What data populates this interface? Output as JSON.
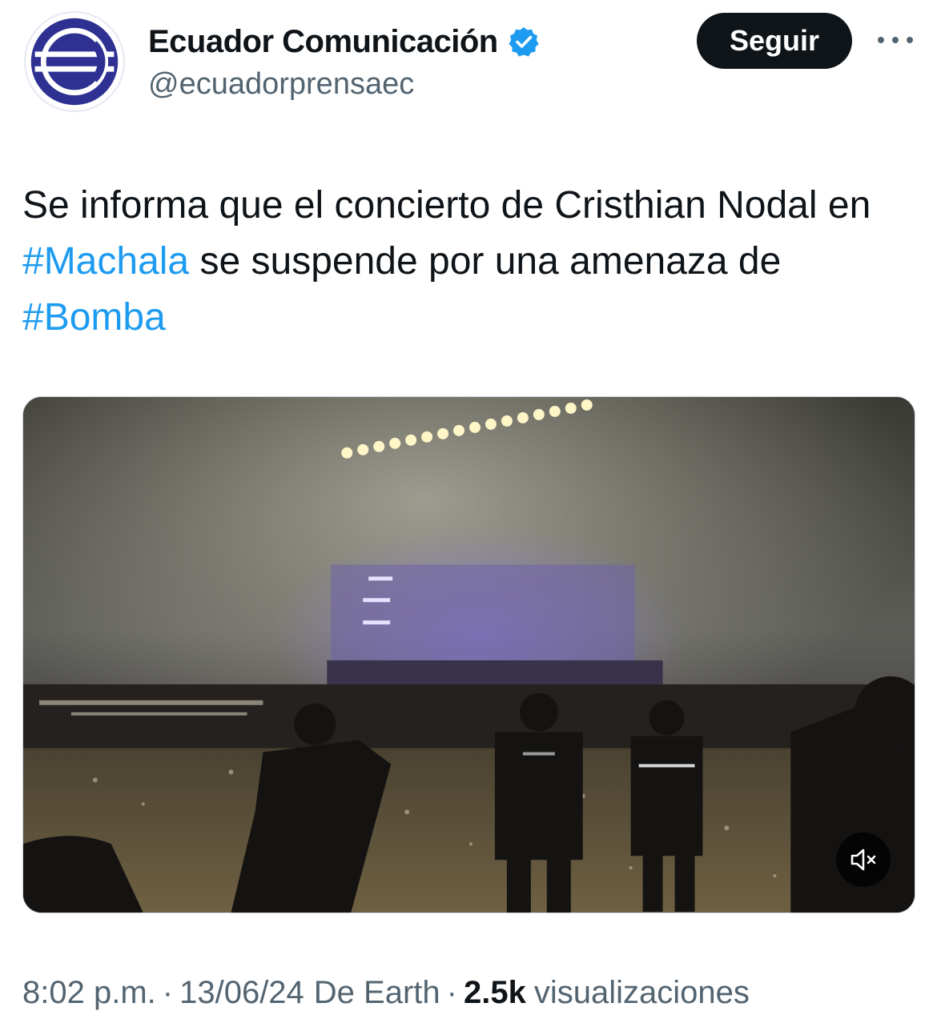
{
  "account": {
    "display_name": "Ecuador Comunicación",
    "handle": "@ecuadorprensaec",
    "verified": true,
    "avatar_icon": "ecuador-comunicacion-logo",
    "brand_color": "#2e3192"
  },
  "actions": {
    "follow_label": "Seguir",
    "more_icon": "more-horizontal-icon"
  },
  "tweet": {
    "text_before": "Se informa que el concierto de Cristhian Nodal en ",
    "hashtag_1": "#Machala",
    "text_middle": " se suspende por una amenaza de ",
    "hashtag_2": "#Bomba",
    "hashtag_color": "#1d9bf0"
  },
  "media": {
    "type": "video",
    "description_icon": "video-thumbnail-concert-stage-police",
    "mute_icon": "muted-speaker-icon"
  },
  "meta": {
    "time": "8:02 p.m.",
    "date": "13/06/24",
    "source": "De Earth",
    "separator": "·",
    "views_count": "2.5k",
    "views_label": "visualizaciones"
  }
}
